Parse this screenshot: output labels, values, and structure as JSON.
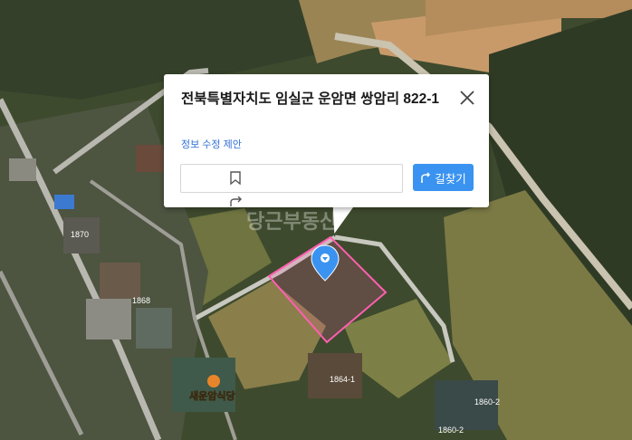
{
  "popup": {
    "title": "전북특별자치도 임실군 운암면 쌍암리 822-1",
    "edit_link": "정보 수정 제안",
    "route_button": "길찾기",
    "close_icon": "close-icon",
    "bookmark_icon": "bookmark-icon",
    "share_icon": "share-icon",
    "route_icon": "route-icon"
  },
  "map": {
    "watermark": "당근부동산",
    "parcel_labels": [
      "1870",
      "1868",
      "1864-1",
      "1860-2",
      "1860-2"
    ],
    "poi_name": "새운암식당",
    "marker_icon": "location-pin-icon",
    "parcel_outline_color": "#ff5fb0",
    "route_button_color": "#3a93f0"
  }
}
